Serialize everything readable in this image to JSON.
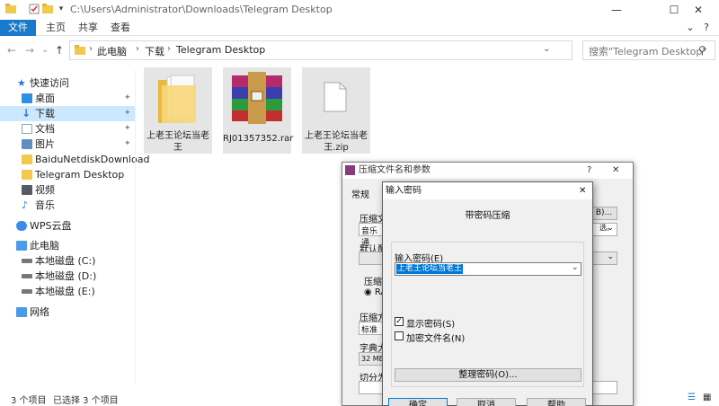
{
  "titlebar": {
    "path": "C:\\Users\\Administrator\\Downloads\\Telegram Desktop",
    "minimize": "—",
    "maximize": "☐",
    "close": "✕"
  },
  "ribbon": {
    "tabs": [
      "文件",
      "主页",
      "共享",
      "查看"
    ],
    "expand": "⌄",
    "help": "?"
  },
  "nav": {
    "back": "←",
    "forward": "→",
    "recent": "⌄",
    "up": "↑",
    "breadcrumb": [
      "此电脑",
      "下载",
      "Telegram Desktop"
    ],
    "dropdown": "⌄",
    "refresh": "↻",
    "search_placeholder": "搜索\"Telegram Desktop\"",
    "search_icon": "⚲"
  },
  "sidebar": {
    "items": [
      {
        "label": "快速访问",
        "icon": "star-icon",
        "color": "#2b78d8",
        "pinned": false
      },
      {
        "label": "桌面",
        "icon": "desktop-icon",
        "color": "#2b8fe8",
        "pinned": true
      },
      {
        "label": "下载",
        "icon": "download-icon",
        "color": "#2b78d8",
        "pinned": true,
        "selected": true
      },
      {
        "label": "文档",
        "icon": "document-icon",
        "color": "#8aa0b8",
        "pinned": true
      },
      {
        "label": "图片",
        "icon": "picture-icon",
        "color": "#5f8fbf",
        "pinned": true
      },
      {
        "label": "BaiduNetdiskDownload",
        "icon": "folder-icon",
        "color": "#f2c94c",
        "pinned": false
      },
      {
        "label": "Telegram Desktop",
        "icon": "folder-icon",
        "color": "#f2c94c",
        "pinned": false
      },
      {
        "label": "视频",
        "icon": "video-icon",
        "color": "#555b66",
        "pinned": false
      },
      {
        "label": "音乐",
        "icon": "music-icon",
        "color": "#2b78d8",
        "pinned": false
      },
      {
        "label": "WPS云盘",
        "icon": "cloud-icon",
        "color": "#3c8be6",
        "pinned": false
      },
      {
        "label": "此电脑",
        "icon": "computer-icon",
        "color": "#4a9be8",
        "pinned": false
      },
      {
        "label": "本地磁盘 (C:)",
        "icon": "drive-icon",
        "color": "#777777",
        "pinned": false
      },
      {
        "label": "本地磁盘 (D:)",
        "icon": "drive-icon",
        "color": "#777777",
        "pinned": false
      },
      {
        "label": "本地磁盘 (E:)",
        "icon": "drive-icon",
        "color": "#777777",
        "pinned": false
      },
      {
        "label": "网络",
        "icon": "network-icon",
        "color": "#4a9be8",
        "pinned": false
      }
    ],
    "pin_glyph": "📌"
  },
  "files": [
    {
      "name": "上老王论坛当老王",
      "type": "folder"
    },
    {
      "name": "RJ01357352.rar",
      "type": "rar"
    },
    {
      "name": "上老王论坛当老王.zip",
      "type": "zip"
    }
  ],
  "status": {
    "count": "3 个项目",
    "selected": "已选择 3 个项目"
  },
  "rar_dialog": {
    "title": "压缩文件名和参数",
    "help": "?",
    "close": "✕",
    "tab_general": "常规",
    "label_archive": "压缩文",
    "archive_value": "音乐通",
    "label_default": "默认配",
    "label_format": "压缩文",
    "format_option": "RA",
    "label_method": "压缩方",
    "method_value": "标准",
    "label_dict": "字典大",
    "dict_value": "32 MB",
    "label_split": "切分为",
    "browse_suffix": "B)...",
    "note_suffix": "选。"
  },
  "pwd_dialog": {
    "title": "输入密码",
    "close": "✕",
    "heading": "带密码压缩",
    "label_enter": "输入密码(E)",
    "password_value": "上老王论坛当老王",
    "show_password": "显示密码(S)",
    "show_password_checked": true,
    "encrypt_names": "加密文件名(N)",
    "encrypt_names_checked": false,
    "organize_button": "整理密码(O)...",
    "ok_button": "确定",
    "cancel_button": "取消",
    "help_button": "帮助"
  }
}
